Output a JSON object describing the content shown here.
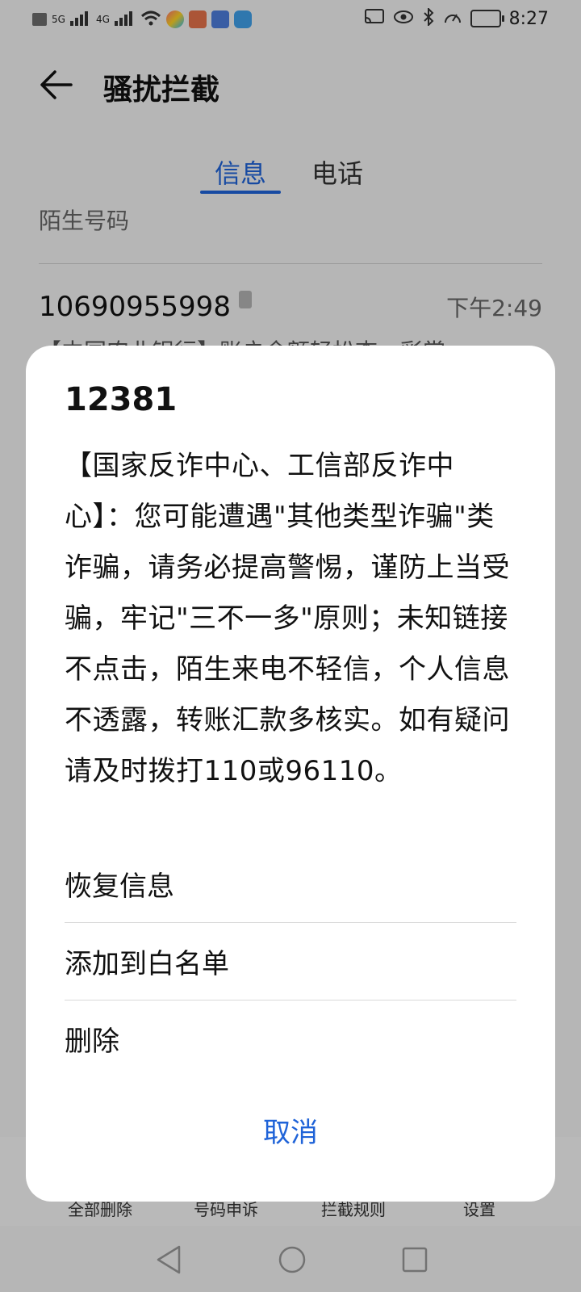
{
  "status_bar": {
    "network_left": "5G",
    "network_right": "4G",
    "time": "8:27",
    "icons": [
      "sim-icon",
      "signal-5g-icon",
      "signal-4g-icon",
      "wifi-icon",
      "app-icon",
      "app-icon",
      "app-icon",
      "app-icon",
      "cast-icon",
      "eye-icon",
      "bluetooth-icon",
      "speed-icon",
      "battery-icon"
    ]
  },
  "header": {
    "title": "骚扰拦截"
  },
  "tabs": [
    {
      "label": "信息",
      "active": true
    },
    {
      "label": "电话",
      "active": false
    }
  ],
  "section": {
    "label": "陌生号码"
  },
  "list": [
    {
      "number": "10690955998",
      "time": "下午2:49",
      "preview": "【中国农业银行】账户余额轻松查，彩掌"
    }
  ],
  "toolbar": {
    "items": [
      "全部删除",
      "号码申诉",
      "拦截规则",
      "设置"
    ]
  },
  "dialog": {
    "title": "12381",
    "body": "【国家反诈中心、工信部反诈中心】：您可能遭遇\"其他类型诈骗\"类诈骗，请务必提高警惕，谨防上当受骗，牢记\"三不一多\"原则；未知链接不点击，陌生来电不轻信，个人信息不透露，转账汇款多核实。如有疑问请及时拨打110或96110。",
    "options": [
      "恢复信息",
      "添加到白名单",
      "删除"
    ],
    "cancel": "取消"
  },
  "colors": {
    "accent": "#1f63d8",
    "scrim": "rgba(0,0,0,0.25)"
  }
}
